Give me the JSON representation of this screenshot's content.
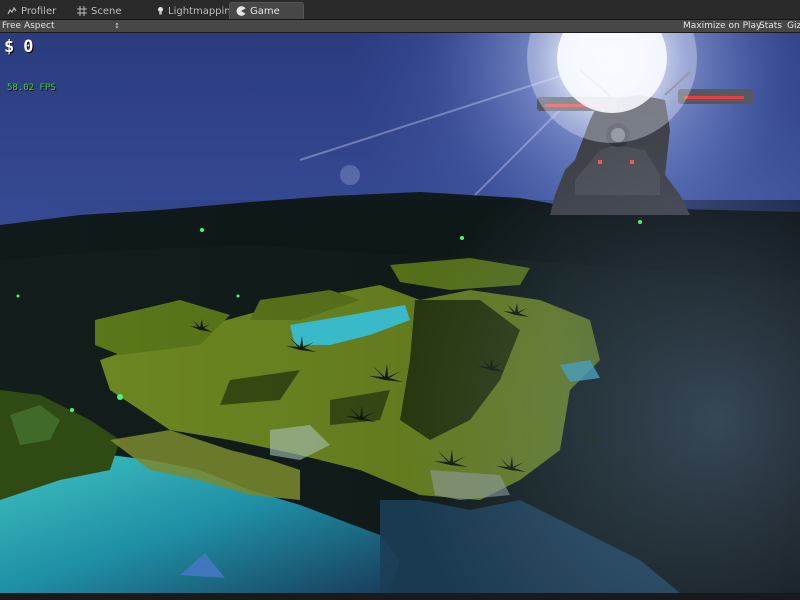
{
  "tabs": [
    {
      "label": "Profiler",
      "icon": "profiler-icon",
      "active": false
    },
    {
      "label": "Scene",
      "icon": "grid-icon",
      "active": false
    },
    {
      "label": "Lightmapping",
      "icon": "light-bulb-icon",
      "active": false
    },
    {
      "label": "Game",
      "icon": "pacman-icon",
      "active": true
    }
  ],
  "toolbar": {
    "aspect": "Free Aspect",
    "maximize_on_play": "Maximize on Play",
    "stats": "Stats",
    "gizmos": "Giz"
  },
  "hud": {
    "currency_symbol": "$",
    "money": "0",
    "fps": "58.02 FPS"
  },
  "colors": {
    "sky_top": "#2c3f86",
    "sky_horizon": "#5b74c4",
    "grass": "#6f8a22",
    "water": "#2aa6a8",
    "fps_text": "#39d94a"
  }
}
